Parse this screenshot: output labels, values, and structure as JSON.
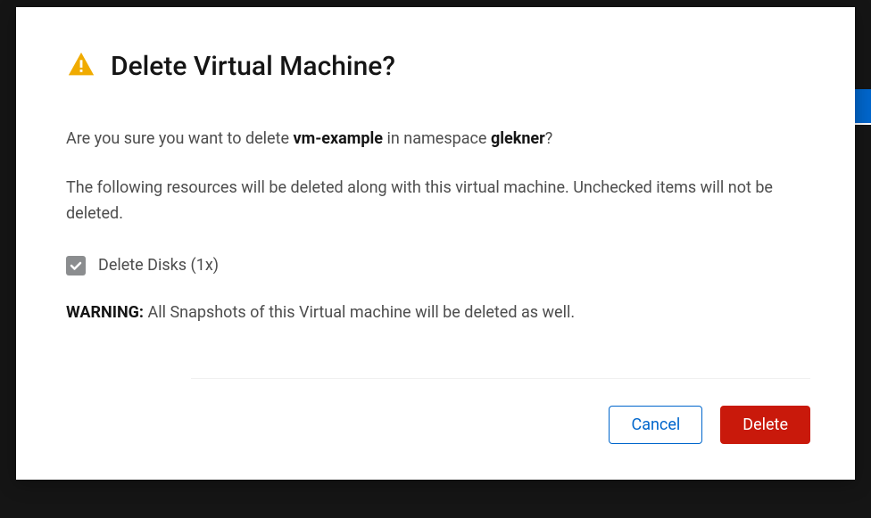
{
  "modal": {
    "title": "Delete Virtual Machine?",
    "confirm": {
      "prefix": "Are you sure you want to delete ",
      "vm_name": "vm-example",
      "mid": " in namespace ",
      "namespace": "glekner",
      "suffix": "?"
    },
    "resources_text": "The following resources will be deleted along with this virtual machine. Unchecked items will not be deleted.",
    "checkbox": {
      "label": "Delete Disks (1x)",
      "checked": true
    },
    "warning": {
      "label": "WARNING:",
      "text": " All Snapshots of this Virtual machine will be deleted as well."
    },
    "buttons": {
      "cancel": "Cancel",
      "delete": "Delete"
    }
  }
}
